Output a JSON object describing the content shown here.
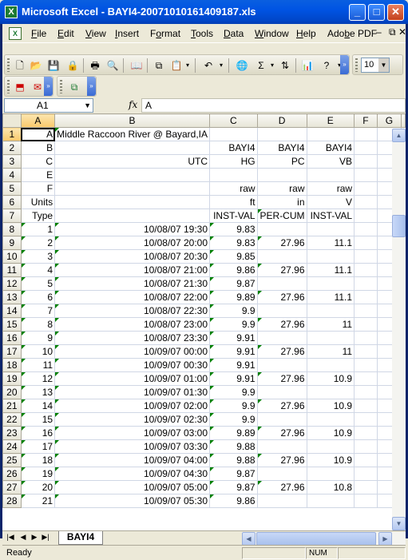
{
  "window": {
    "title": "Microsoft Excel - BAYI4-20071010161409187.xls"
  },
  "menubar": {
    "items": [
      {
        "label": "File",
        "u": "F"
      },
      {
        "label": "Edit",
        "u": "E"
      },
      {
        "label": "View",
        "u": "V"
      },
      {
        "label": "Insert",
        "u": "I"
      },
      {
        "label": "Format",
        "u": "o"
      },
      {
        "label": "Tools",
        "u": "T"
      },
      {
        "label": "Data",
        "u": "D"
      },
      {
        "label": "Window",
        "u": "W"
      },
      {
        "label": "Help",
        "u": "H"
      },
      {
        "label": "Adobe PDF",
        "u": "b"
      }
    ]
  },
  "toolbar": {
    "font_size": "10",
    "sum_symbol": "Σ"
  },
  "formula_bar": {
    "name_box": "A1",
    "fx": "fx",
    "content": "A"
  },
  "grid": {
    "columns": [
      "A",
      "B",
      "C",
      "D",
      "E",
      "F",
      "G"
    ],
    "rows": [
      {
        "n": "1",
        "a": "A",
        "b": "Middle Raccoon River @ Bayard,IA",
        "c": "",
        "d": "",
        "e": "",
        "ta": true
      },
      {
        "n": "2",
        "a": "B",
        "b": "",
        "c": "BAYI4",
        "d": "BAYI4",
        "e": "BAYI4"
      },
      {
        "n": "3",
        "a": "C",
        "b": "UTC",
        "c": "HG",
        "d": "PC",
        "e": "VB"
      },
      {
        "n": "4",
        "a": "E",
        "b": "",
        "c": "",
        "d": "",
        "e": ""
      },
      {
        "n": "5",
        "a": "F",
        "b": "",
        "c": "raw",
        "d": "raw",
        "e": "raw"
      },
      {
        "n": "6",
        "a": "Units",
        "b": "",
        "c": "ft",
        "d": "in",
        "e": "V"
      },
      {
        "n": "7",
        "a": "Type",
        "b": "",
        "c": "INST-VAL",
        "d": "PER-CUM",
        "e": "INST-VAL"
      },
      {
        "n": "8",
        "a": "1",
        "b": "10/08/07 19:30",
        "c": "9.83",
        "d": "",
        "e": ""
      },
      {
        "n": "9",
        "a": "2",
        "b": "10/08/07 20:00",
        "c": "9.83",
        "d": "27.96",
        "e": "11.1"
      },
      {
        "n": "10",
        "a": "3",
        "b": "10/08/07 20:30",
        "c": "9.85",
        "d": "",
        "e": ""
      },
      {
        "n": "11",
        "a": "4",
        "b": "10/08/07 21:00",
        "c": "9.86",
        "d": "27.96",
        "e": "11.1"
      },
      {
        "n": "12",
        "a": "5",
        "b": "10/08/07 21:30",
        "c": "9.87",
        "d": "",
        "e": ""
      },
      {
        "n": "13",
        "a": "6",
        "b": "10/08/07 22:00",
        "c": "9.89",
        "d": "27.96",
        "e": "11.1"
      },
      {
        "n": "14",
        "a": "7",
        "b": "10/08/07 22:30",
        "c": "9.9",
        "d": "",
        "e": ""
      },
      {
        "n": "15",
        "a": "8",
        "b": "10/08/07 23:00",
        "c": "9.9",
        "d": "27.96",
        "e": "11"
      },
      {
        "n": "16",
        "a": "9",
        "b": "10/08/07 23:30",
        "c": "9.91",
        "d": "",
        "e": ""
      },
      {
        "n": "17",
        "a": "10",
        "b": "10/09/07 00:00",
        "c": "9.91",
        "d": "27.96",
        "e": "11"
      },
      {
        "n": "18",
        "a": "11",
        "b": "10/09/07 00:30",
        "c": "9.91",
        "d": "",
        "e": ""
      },
      {
        "n": "19",
        "a": "12",
        "b": "10/09/07 01:00",
        "c": "9.91",
        "d": "27.96",
        "e": "10.9"
      },
      {
        "n": "20",
        "a": "13",
        "b": "10/09/07 01:30",
        "c": "9.9",
        "d": "",
        "e": ""
      },
      {
        "n": "21",
        "a": "14",
        "b": "10/09/07 02:00",
        "c": "9.9",
        "d": "27.96",
        "e": "10.9"
      },
      {
        "n": "22",
        "a": "15",
        "b": "10/09/07 02:30",
        "c": "9.9",
        "d": "",
        "e": ""
      },
      {
        "n": "23",
        "a": "16",
        "b": "10/09/07 03:00",
        "c": "9.89",
        "d": "27.96",
        "e": "10.9"
      },
      {
        "n": "24",
        "a": "17",
        "b": "10/09/07 03:30",
        "c": "9.88",
        "d": "",
        "e": ""
      },
      {
        "n": "25",
        "a": "18",
        "b": "10/09/07 04:00",
        "c": "9.88",
        "d": "27.96",
        "e": "10.9"
      },
      {
        "n": "26",
        "a": "19",
        "b": "10/09/07 04:30",
        "c": "9.87",
        "d": "",
        "e": ""
      },
      {
        "n": "27",
        "a": "20",
        "b": "10/09/07 05:00",
        "c": "9.87",
        "d": "27.96",
        "e": "10.8"
      },
      {
        "n": "28",
        "a": "21",
        "b": "10/09/07 05:30",
        "c": "9.86",
        "d": "",
        "e": ""
      }
    ]
  },
  "sheet_tabs": [
    {
      "label": "BAYI4"
    }
  ],
  "status": {
    "text": "Ready",
    "num": "NUM"
  }
}
